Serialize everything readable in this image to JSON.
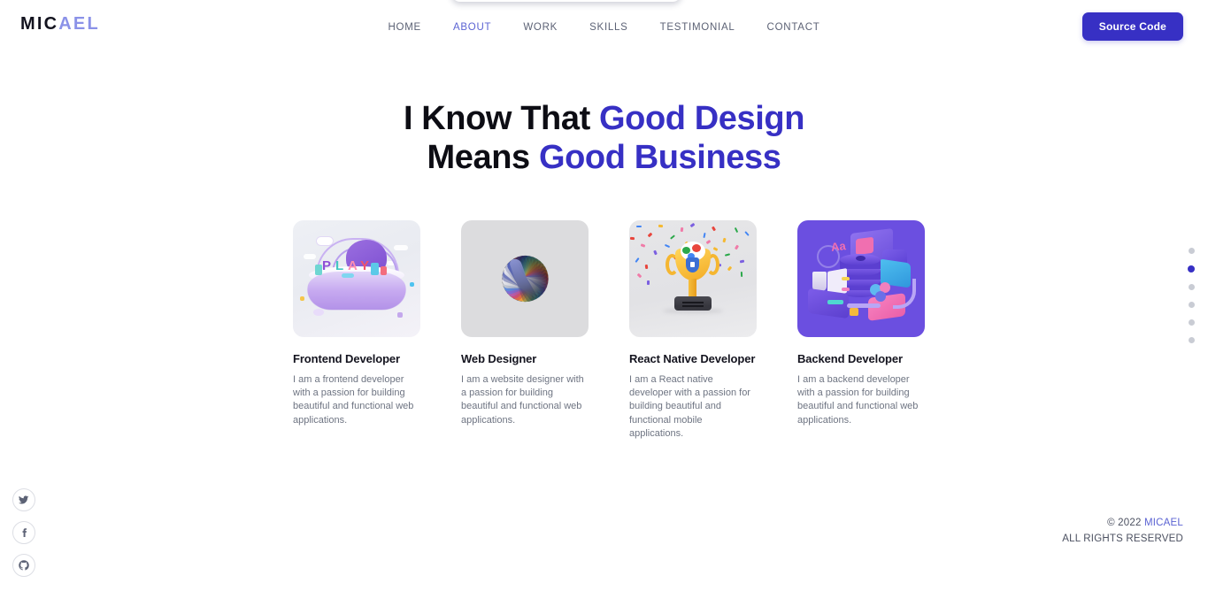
{
  "brand": {
    "part_dark": "MIC",
    "part_blue": "AEL"
  },
  "nav": {
    "items": [
      {
        "label": "HOME",
        "active": false
      },
      {
        "label": "ABOUT",
        "active": true
      },
      {
        "label": "WORK",
        "active": false
      },
      {
        "label": "SKILLS",
        "active": false
      },
      {
        "label": "TESTIMONIAL",
        "active": false
      },
      {
        "label": "CONTACT",
        "active": false
      }
    ],
    "cta_label": "Source Code"
  },
  "heading": {
    "line1_plain": "I Know That ",
    "line1_accent": "Good Design",
    "line2_plain": "Means ",
    "line2_accent": "Good Business"
  },
  "cards": [
    {
      "image_name": "play-island-3d-illustration",
      "title": "Frontend Developer",
      "desc": "I am a frontend developer with a passion for building beautiful and functional web applications."
    },
    {
      "image_name": "color-swatch-fan-wheel-illustration",
      "title": "Web Designer",
      "desc": "I am a website designer with a passion for building beautiful and functional web applications."
    },
    {
      "image_name": "gold-trophy-confetti-illustration",
      "title": "React Native Developer",
      "desc": "I am a React native developer with a passion for building beautiful and functional mobile applications."
    },
    {
      "image_name": "backend-server-isometric-illustration",
      "title": "Backend Developer",
      "desc": "I am a backend developer with a passion for building beautiful and functional web applications."
    }
  ],
  "section_dots": {
    "count": 6,
    "active_index": 1
  },
  "social": [
    {
      "name": "twitter-icon"
    },
    {
      "name": "facebook-icon"
    },
    {
      "name": "github-icon"
    }
  ],
  "footer": {
    "copyright_prefix": "© 2022 ",
    "copyright_brand": "MICAEL",
    "rights": "ALL RIGHTS RESERVED"
  },
  "colors": {
    "accent": "#3730c4",
    "accent_light": "#8b92e8",
    "nav_text": "#5c6275",
    "heading": "#0d0d14",
    "body_text": "#6e7482",
    "dot_inactive": "#c9ccd4"
  }
}
